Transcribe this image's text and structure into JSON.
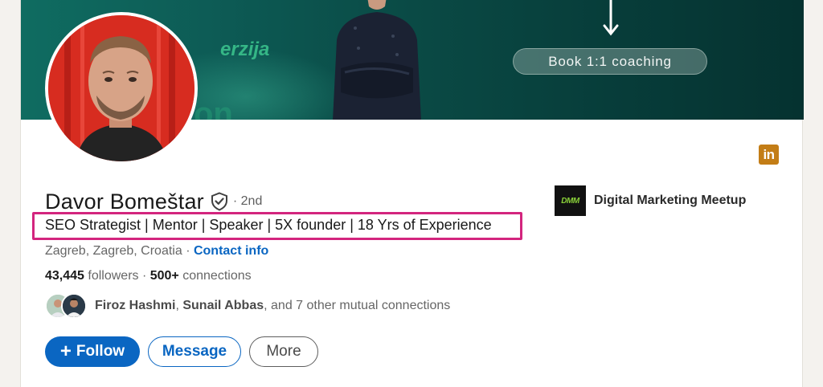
{
  "banner": {
    "brand_text": "erzija",
    "brand_text_2": "on",
    "coaching_button": "Book 1:1 coaching"
  },
  "profile": {
    "name": "Davor Bomeštar",
    "degree": "· 2nd",
    "headline": "SEO Strategist | Mentor | Speaker | 5X founder | 18 Yrs of Experience",
    "location": "Zagreb, Zagreb, Croatia",
    "separator": " · ",
    "contact_info": "Contact info",
    "followers_count": "43,445",
    "followers_label": " followers",
    "connections_sep": "  · ",
    "connections_count": "500+",
    "connections_label": " connections",
    "mutual": {
      "name1": "Firoz Hashmi",
      "comma": ", ",
      "name2": "Sunail Abbas",
      "rest": ", and 7 other mutual connections"
    }
  },
  "company": {
    "logo_text": "DMM",
    "name": "Digital Marketing Meetup"
  },
  "actions": {
    "follow": "Follow",
    "follow_icon": "+",
    "message": "Message",
    "more": "More"
  },
  "icons": {
    "linkedin_badge": "in"
  },
  "colors": {
    "primary": "#0a66c2",
    "highlight_border": "#d3257e",
    "linkedin_badge": "#c37d16"
  }
}
